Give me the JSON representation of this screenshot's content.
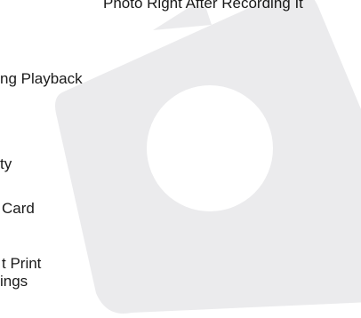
{
  "background_color": "#ffffff",
  "camera_icon": {
    "name": "camera-icon",
    "fill": "#ebebed",
    "lens_fill": "#ffffff"
  },
  "toc_items": [
    "Photo Right After Recording It",
    "ng Playback",
    "ty",
    "Card",
    "t Print",
    "ings"
  ]
}
